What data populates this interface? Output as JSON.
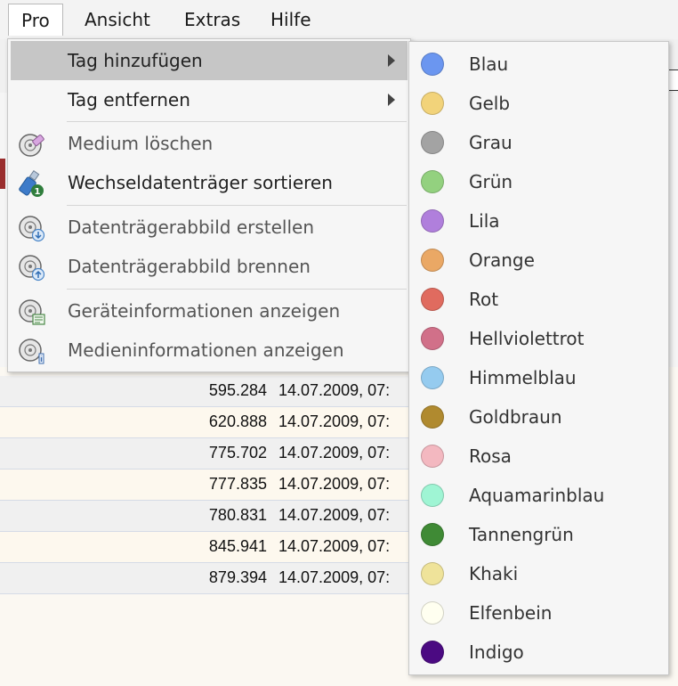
{
  "menubar": {
    "items": [
      {
        "label": "Pro",
        "active": true
      },
      {
        "label": "Ansicht",
        "active": false
      },
      {
        "label": "Extras",
        "active": false
      },
      {
        "label": "Hilfe",
        "active": false
      }
    ]
  },
  "menu": {
    "items": [
      {
        "label": "Tag hinzufügen",
        "icon": "",
        "submenu": true,
        "highlighted": true
      },
      {
        "label": "Tag entfernen",
        "icon": "",
        "submenu": true
      },
      {
        "label": "Medium löschen",
        "icon": "disc-erase-icon",
        "disabled": true
      },
      {
        "label": "Wechseldatenträger sortieren",
        "icon": "usb-drive-icon"
      },
      {
        "label": "Datenträgerabbild erstellen",
        "icon": "disc-image-create-icon",
        "disabled": true
      },
      {
        "label": "Datenträgerabbild brennen",
        "icon": "disc-burn-icon",
        "disabled": true
      },
      {
        "label": "Geräteinformationen anzeigen",
        "icon": "disc-device-info-icon",
        "disabled": true
      },
      {
        "label": "Medieninformationen anzeigen",
        "icon": "disc-media-info-icon",
        "disabled": true
      }
    ]
  },
  "submenu": {
    "items": [
      {
        "label": "Blau",
        "color": "#6b96f0"
      },
      {
        "label": "Gelb",
        "color": "#f2d37a"
      },
      {
        "label": "Grau",
        "color": "#a3a3a3"
      },
      {
        "label": "Grün",
        "color": "#93d17f"
      },
      {
        "label": "Lila",
        "color": "#b07fdc"
      },
      {
        "label": "Orange",
        "color": "#eaa865"
      },
      {
        "label": "Rot",
        "color": "#e06b5f"
      },
      {
        "label": "Hellviolettrot",
        "color": "#d17089"
      },
      {
        "label": "Himmelblau",
        "color": "#95cbef"
      },
      {
        "label": "Goldbraun",
        "color": "#b08a2f"
      },
      {
        "label": "Rosa",
        "color": "#f3b8c0"
      },
      {
        "label": "Aquamarinblau",
        "color": "#9ff5d4"
      },
      {
        "label": "Tannengrün",
        "color": "#3f8a35"
      },
      {
        "label": "Khaki",
        "color": "#efe39a"
      },
      {
        "label": "Elfenbein",
        "color": "#fffff0"
      },
      {
        "label": "Indigo",
        "color": "#4b0a82"
      }
    ]
  },
  "table": {
    "rows": [
      {
        "size": "595.284",
        "date": "14.07.2009, 07:"
      },
      {
        "size": "620.888",
        "date": "14.07.2009, 07:"
      },
      {
        "size": "775.702",
        "date": "14.07.2009, 07:"
      },
      {
        "size": "777.835",
        "date": "14.07.2009, 07:"
      },
      {
        "size": "780.831",
        "date": "14.07.2009, 07:"
      },
      {
        "size": "845.941",
        "date": "14.07.2009, 07:"
      },
      {
        "size": "879.394",
        "date": "14.07.2009, 07:"
      }
    ]
  }
}
